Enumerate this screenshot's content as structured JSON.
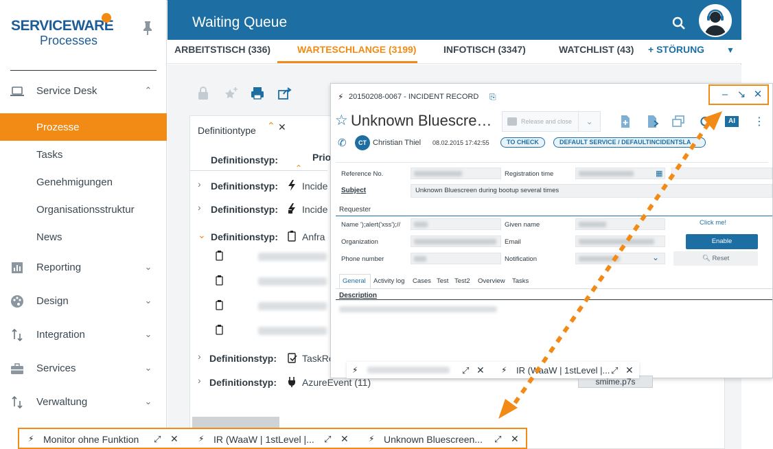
{
  "brand": {
    "logo_top": "SERVICEWARE",
    "logo_bottom": "Processes"
  },
  "sidebar": {
    "items": [
      {
        "label": "Service Desk",
        "icon": "laptop-icon",
        "expanded": true
      },
      {
        "label": "Reporting",
        "icon": "bar-chart-icon"
      },
      {
        "label": "Design",
        "icon": "palette-icon"
      },
      {
        "label": "Integration",
        "icon": "sort-arrows-icon"
      },
      {
        "label": "Services",
        "icon": "briefcase-icon"
      },
      {
        "label": "Verwaltung",
        "icon": "sort-arrows-icon"
      }
    ],
    "subitems": [
      "Prozesse",
      "Tasks",
      "Genehmigungen",
      "Organisationsstruktur",
      "News"
    ]
  },
  "header": {
    "title": "Waiting Queue"
  },
  "tabs": [
    {
      "label": "ARBEITSTISCH (336)"
    },
    {
      "label": "WARTESCHLANGE (3199)",
      "active": true
    },
    {
      "label": "INFOTISCH (3347)"
    },
    {
      "label": "WATCHLIST (43)"
    }
  ],
  "add_tab": "+ STÖRUNG",
  "defpanel": {
    "header": "Definitiontype",
    "col_head": "Definitionstyp:",
    "col_head2": "Prio",
    "rows": [
      {
        "label": "Definitionstyp:",
        "value": "Incide"
      },
      {
        "label": "Definitionstyp:",
        "value": "Incide"
      },
      {
        "label": "Definitionstyp:",
        "value": "Anfra"
      },
      {
        "label": "Definitionstyp:",
        "value": "TaskRe"
      },
      {
        "label": "Definitionstyp:",
        "value": "AzureEvent (11)"
      }
    ]
  },
  "incident": {
    "record": "20150208-0067 - INCIDENT RECORD",
    "title": "Unknown Bluescre…",
    "release_btn": "Release and close",
    "ai": "AI",
    "agent_initials": "CT",
    "agent": "Christian Thiel",
    "date": "08.02.2015 17:42:55",
    "pills": [
      "TO CHECK",
      "DEFAULT SERVICE / DEFAULTINCIDENTSLA"
    ],
    "fields": {
      "reference_no": "Reference No.",
      "registration_time": "Registration time",
      "subject_label": "Subject",
      "subject_value": "Unknown Bluescreen during bootup several times",
      "requester": "Requester",
      "name": "Name ');alert('xss');//",
      "given_name": "Given name",
      "organization": "Organization",
      "email": "Email",
      "phone": "Phone number",
      "notification": "Notification"
    },
    "click_me": "Click me!",
    "enable": "Enable",
    "reset": "Reset",
    "sub_tabs": [
      "General",
      "Activity log",
      "Cases",
      "Test",
      "Test2",
      "Overview",
      "Tasks"
    ],
    "description": "Description"
  },
  "float_taskbar": {
    "item2": "IR (WaaW | 1stLevel |..."
  },
  "smime": "smime.p7s",
  "bottom_taskbar": [
    "Monitor ohne Funktion",
    "IR (WaaW | 1stLevel |...",
    "Unknown Bluescreen..."
  ],
  "colors": {
    "accent": "#f28b16",
    "brand": "#1d6fa3"
  }
}
